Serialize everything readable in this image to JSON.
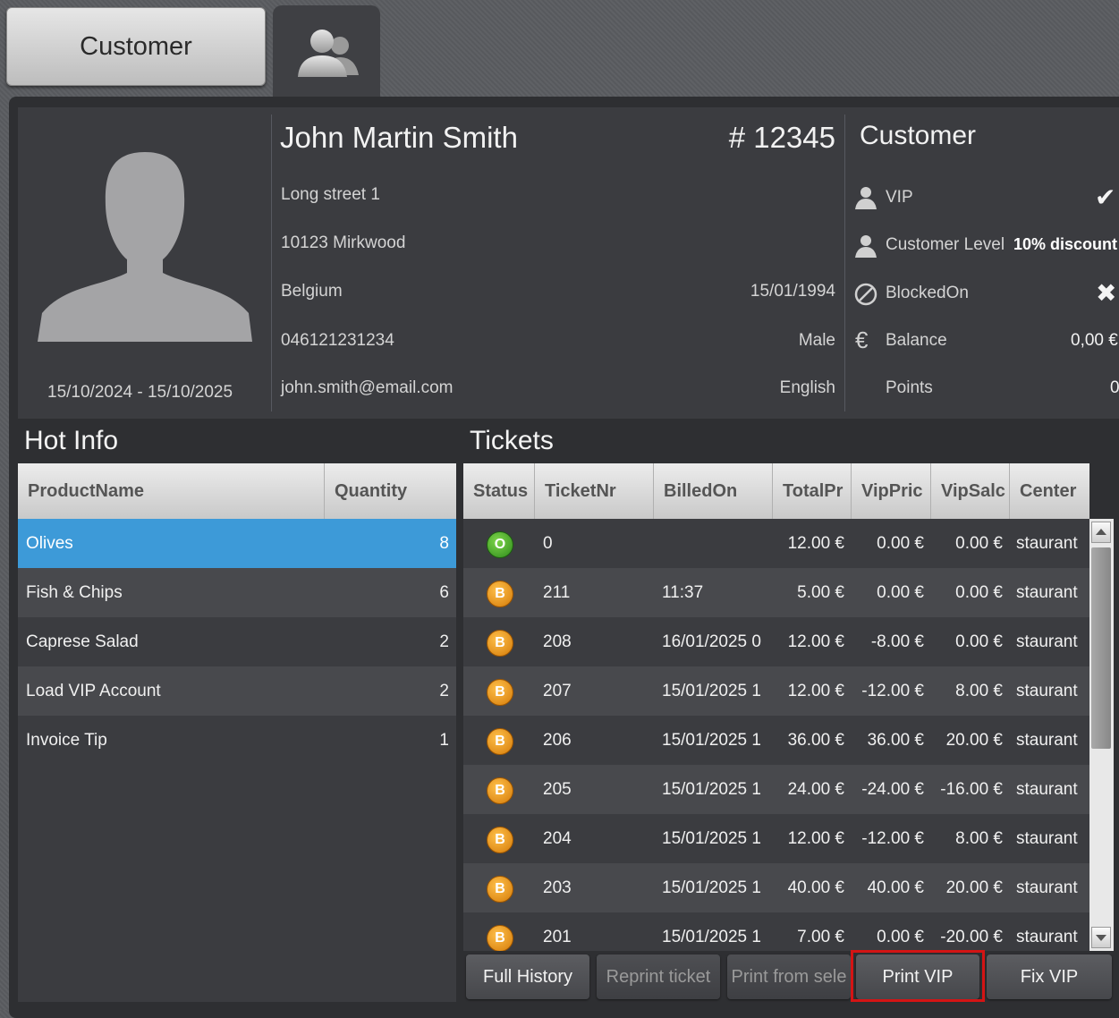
{
  "tabs": {
    "customer_label": "Customer",
    "icon": "customers-icon"
  },
  "customer": {
    "name": "John Martin Smith",
    "number": "# 12345",
    "street": "Long street 1",
    "city": "10123 Mirkwood",
    "country": "Belgium",
    "birthdate": "15/01/1994",
    "phone": "046121231234",
    "gender": "Male",
    "email": "john.smith@email.com",
    "language": "English",
    "validity": "15/10/2024 - 15/10/2025"
  },
  "customer_panel": {
    "title": "Customer",
    "vip_label": "VIP",
    "vip_value": "✔",
    "level_label": "Customer Level",
    "level_value": "10% discount",
    "blocked_label": "BlockedOn",
    "blocked_value": "✖",
    "balance_label": "Balance",
    "balance_value": "0,00 €",
    "points_label": "Points",
    "points_value": "0"
  },
  "hot_info": {
    "title": "Hot Info",
    "columns": [
      "ProductName",
      "Quantity"
    ],
    "rows": [
      {
        "product": "Olives",
        "qty": "8"
      },
      {
        "product": "Fish & Chips",
        "qty": "6"
      },
      {
        "product": "Caprese Salad",
        "qty": "2"
      },
      {
        "product": "Load VIP Account",
        "qty": "2"
      },
      {
        "product": "Invoice Tip",
        "qty": "1"
      }
    ]
  },
  "tickets": {
    "title": "Tickets",
    "columns": [
      "Status",
      "TicketNr",
      "BilledOn",
      "TotalPr",
      "VipPric",
      "VipSalc",
      "Center"
    ],
    "rows": [
      {
        "status": "O",
        "nr": "0",
        "billed": "",
        "total": "12.00 €",
        "vipprice": "0.00 €",
        "vipsaldo": "0.00 €",
        "center": "staurant"
      },
      {
        "status": "B",
        "nr": "211",
        "billed": "11:37",
        "total": "5.00 €",
        "vipprice": "0.00 €",
        "vipsaldo": "0.00 €",
        "center": "staurant"
      },
      {
        "status": "B",
        "nr": "208",
        "billed": "16/01/2025 0",
        "total": "12.00 €",
        "vipprice": "-8.00 €",
        "vipsaldo": "0.00 €",
        "center": "staurant"
      },
      {
        "status": "B",
        "nr": "207",
        "billed": "15/01/2025 1",
        "total": "12.00 €",
        "vipprice": "-12.00 €",
        "vipsaldo": "8.00 €",
        "center": "staurant"
      },
      {
        "status": "B",
        "nr": "206",
        "billed": "15/01/2025 1",
        "total": "36.00 €",
        "vipprice": "36.00 €",
        "vipsaldo": "20.00 €",
        "center": "staurant"
      },
      {
        "status": "B",
        "nr": "205",
        "billed": "15/01/2025 1",
        "total": "24.00 €",
        "vipprice": "-24.00 €",
        "vipsaldo": "-16.00 €",
        "center": "staurant"
      },
      {
        "status": "B",
        "nr": "204",
        "billed": "15/01/2025 1",
        "total": "12.00 €",
        "vipprice": "-12.00 €",
        "vipsaldo": "8.00 €",
        "center": "staurant"
      },
      {
        "status": "B",
        "nr": "203",
        "billed": "15/01/2025 1",
        "total": "40.00 €",
        "vipprice": "40.00 €",
        "vipsaldo": "20.00 €",
        "center": "staurant"
      },
      {
        "status": "B",
        "nr": "201",
        "billed": "15/01/2025 1",
        "total": "7.00 €",
        "vipprice": "0.00 €",
        "vipsaldo": "-20.00 €",
        "center": "staurant"
      }
    ]
  },
  "buttons": {
    "full_history": "Full History",
    "reprint": "Reprint ticket",
    "print_selection": "Print from sele",
    "print_vip": "Print VIP",
    "fix_vip": "Fix VIP"
  },
  "colors": {
    "selected_row": "#3d9ad8",
    "status_open": "#4cae2c",
    "status_billed": "#f09a1a",
    "highlight": "#d41414"
  }
}
